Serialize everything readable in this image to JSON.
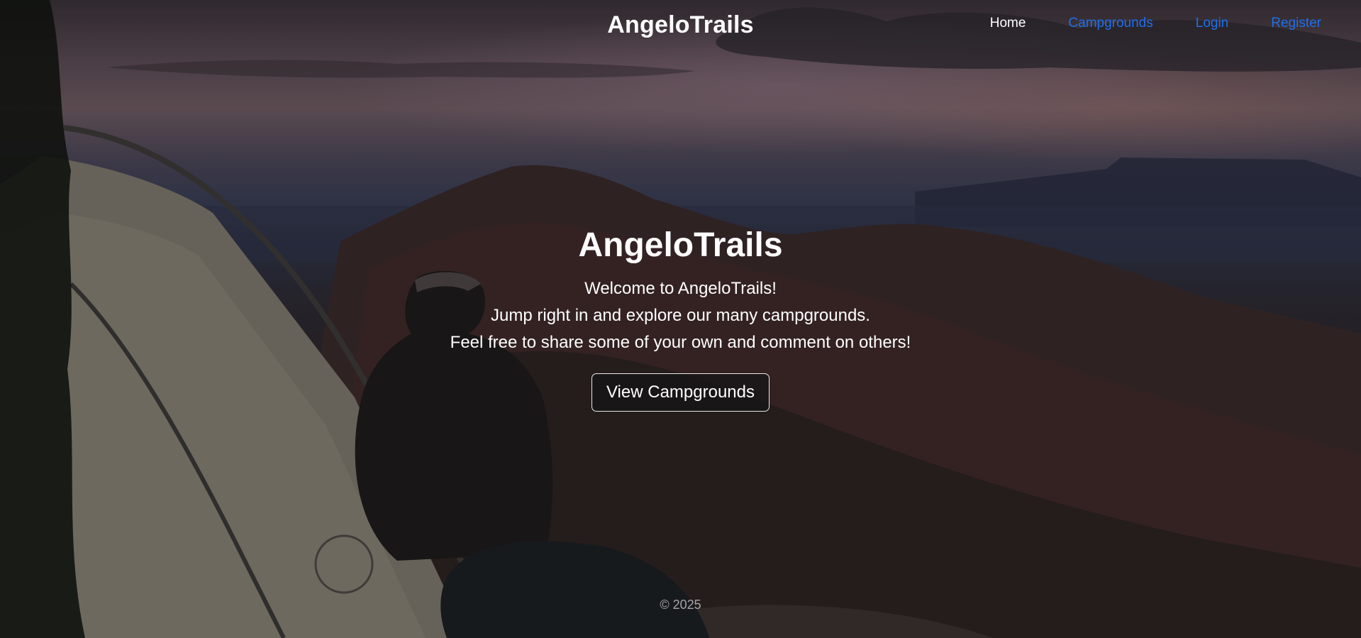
{
  "header": {
    "brand": "AngeloTrails",
    "nav": {
      "home": "Home",
      "campgrounds": "Campgrounds",
      "login": "Login",
      "register": "Register"
    }
  },
  "hero": {
    "title": "AngeloTrails",
    "lines": [
      "Welcome to AngeloTrails!",
      "Jump right in and explore our many campgrounds.",
      "Feel free to share some of your own and comment on others!"
    ],
    "button_label": "View Campgrounds"
  },
  "footer": {
    "copyright": "© 2025"
  },
  "colors": {
    "nav_link": "#1f6feb",
    "nav_active": "#ffffff",
    "text": "#ffffff"
  }
}
